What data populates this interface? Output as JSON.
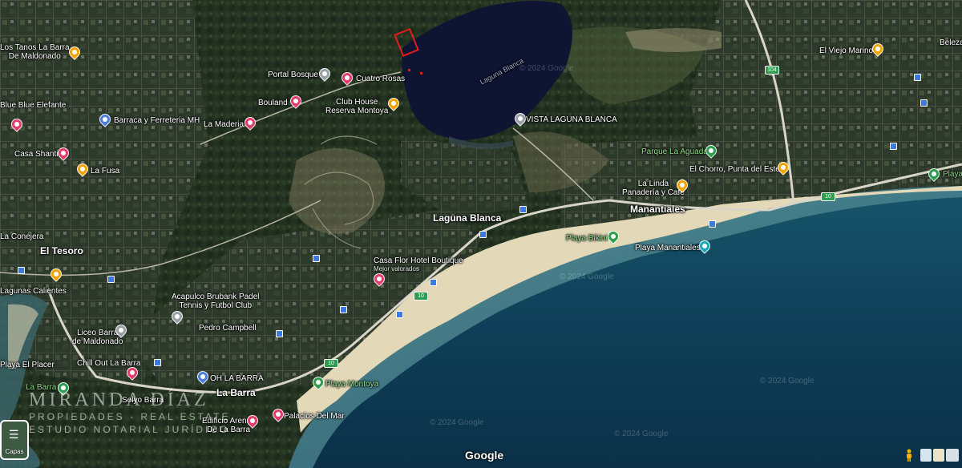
{
  "map": {
    "type": "satellite",
    "attribution": "Google",
    "copyright": "© 2024 Google"
  },
  "places": {
    "los_tanos": "Los Tanos La Barra\nDe Maldonado",
    "portal_bosque": "Portal Bosque",
    "cuatro_rosas": "Cuatro Rosas",
    "laguna_blanca_water": "Laguna Blanca",
    "blue_blue": "Blue Blue Elefante",
    "barraca": "Barraca y Ferreteria MH",
    "bouland": "Bouland",
    "club_house": "Club House\nReserva Montoya",
    "la_maderia": "La Maderia",
    "vista_laguna": "VISTA LAGUNA BLANCA",
    "casa_shanti": "Casa Shanti",
    "la_fusa": "La Fusa",
    "parque_aguada": "Parque La Aguada",
    "el_chorro": "El Chorro, Punta del Este",
    "la_linda": "La Linda\nPanadería y Café",
    "el_viejo_marino": "El Viejo Marino",
    "beleza": "Beleza",
    "laguna_blanca_area": "Laguna Blanca",
    "manantiales": "Manantiales",
    "la_conejera": "La Conejera",
    "playa_bikini": "Playa Bikini",
    "playa_manantiales": "Playa Manantiales",
    "el_tesoro": "El Tesoro",
    "casa_flor": "Casa Flor Hotel Boutique",
    "casa_flor_sub": "Mejor valorados",
    "lagunas": "Lagunas Calientes",
    "acapulco": "Acapulco Brubank Padel\nTennis y Futbol Club",
    "pedro_campbell": "Pedro Campbell",
    "liceo": "Liceo Barra\nde Maldonado",
    "playa_el_placer": "Playa El Placer",
    "chill_out": "Chill Out La Barra",
    "oh_la_barra": "OH LA BARRA",
    "la_barra_park": "La Barra",
    "la_barra_town": "La Barra",
    "playa_montoya": "Playa Montoya",
    "sel_yo": "Selyo Barra",
    "palacios": "Palacios Del Mar",
    "edificio": "Edificio Arenas\nDe La Barra",
    "right_edge": "Playa"
  },
  "roads": {
    "r10a": "10",
    "r10b": "10",
    "r10c": "10",
    "r104": "104"
  },
  "watermark": {
    "title": "MIRANDA DÍAZ",
    "line1": "PROPIEDADES · REAL ESTATE",
    "line2": "ESTUDIO NOTARIAL JURÍDICO"
  },
  "controls": {
    "capas_label": "Capas",
    "logo": "Google"
  },
  "icons": [
    "orange-pin",
    "pink-pin",
    "blue-pin",
    "green-pin",
    "teal-pin",
    "bus-stop-icon",
    "layers-icon",
    "pegman-icon"
  ]
}
